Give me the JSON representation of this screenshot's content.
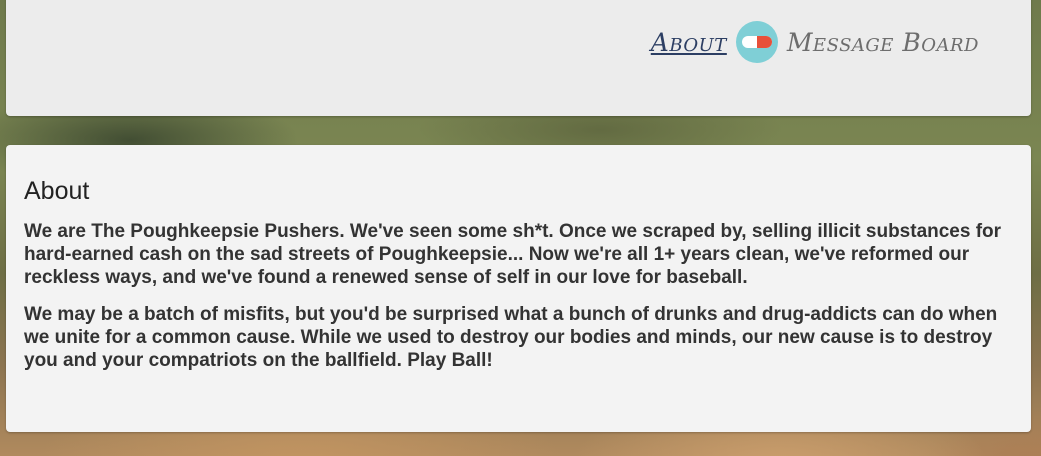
{
  "nav": {
    "about_label": "About",
    "message_board_label": "Message Board",
    "logo_icon": "pill-icon",
    "colors": {
      "about": "#2c3e63",
      "message_board": "#6d6d6d",
      "pill_circle": "#7fcfd6",
      "pill_white": "#ffffff",
      "pill_red": "#e8503a"
    }
  },
  "about": {
    "heading": "About",
    "paragraphs": [
      "We are The Poughkeepsie Pushers. We've seen some sh*t. Once we scraped by, selling illicit substances for hard-earned cash on the sad streets of Poughkeepsie... Now we're all 1+ years clean, we've reformed our reckless ways, and we've found a renewed sense of self in our love for baseball.",
      "We may be a batch of misfits, but you'd be surprised what a bunch of drunks and drug-addicts can do when we unite for a common cause. While we used to destroy our bodies and minds, our new cause is to destroy you and your compatriots on the ballfield. Play Ball!"
    ]
  }
}
